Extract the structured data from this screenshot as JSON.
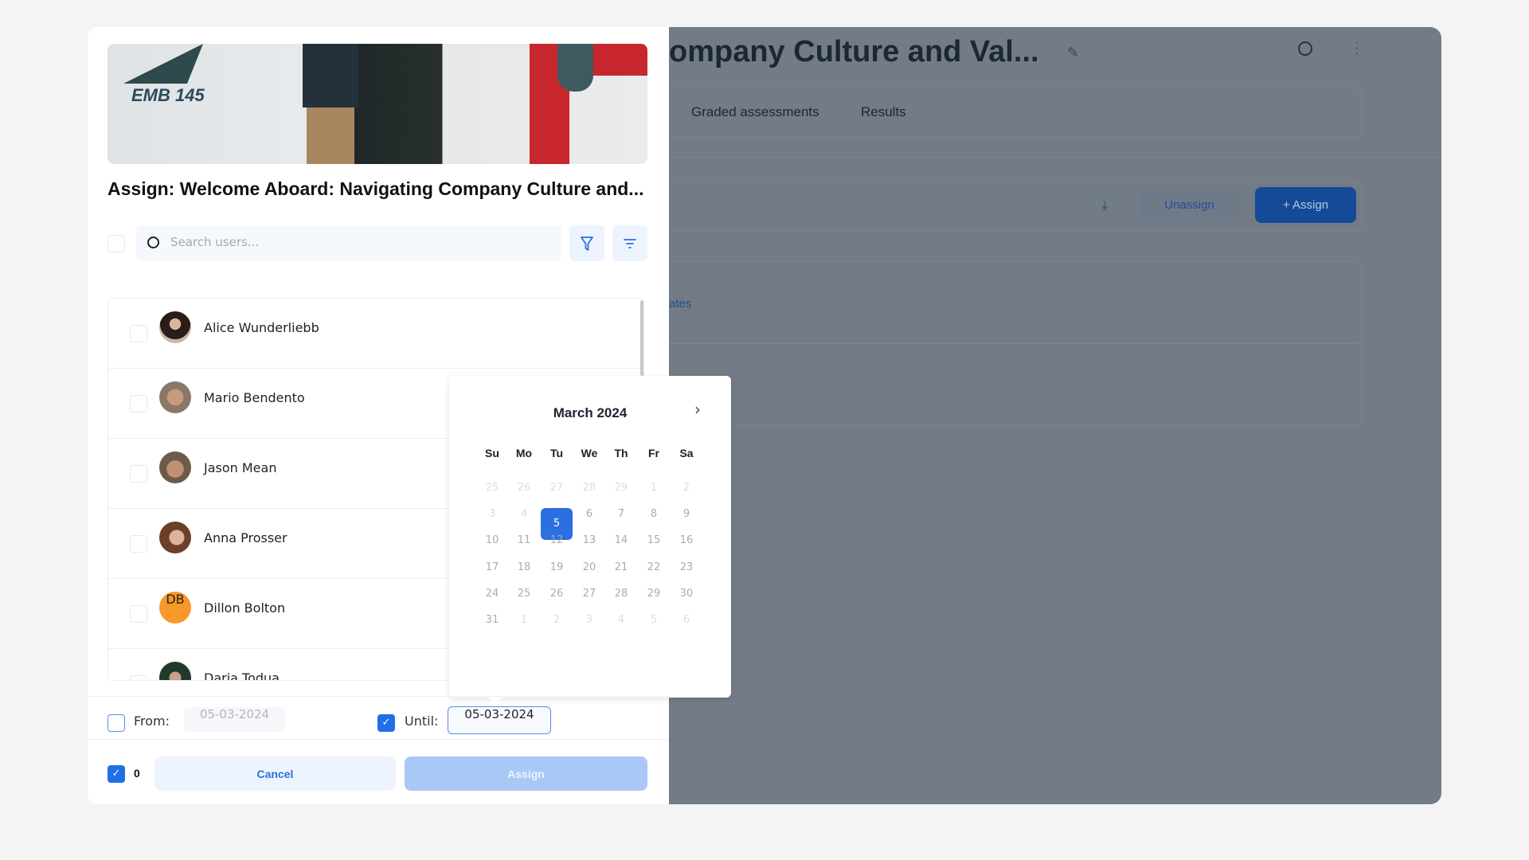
{
  "background_page": {
    "title": "ompany Culture and Val...",
    "tabs": [
      "Graded assessments",
      "Results"
    ],
    "unassign_label": "Unassign",
    "assign_label": "+ Assign",
    "link_fragment": "ates"
  },
  "modal": {
    "title": "Assign: Welcome Aboard: Navigating Company Culture and...",
    "hero_text": "EMB 145",
    "search": {
      "placeholder": "Search users..."
    },
    "users": [
      {
        "name": "Alice Wunderliebb",
        "avatar": "photo"
      },
      {
        "name": "Mario Bendento",
        "avatar": "photo"
      },
      {
        "name": "Jason Mean",
        "avatar": "photo"
      },
      {
        "name": "Anna Prosser",
        "avatar": "photo"
      },
      {
        "name": "Dillon Bolton",
        "initials": "DB",
        "avatar_color": "#f7982a"
      },
      {
        "name": "Daria Todua",
        "avatar": "photo"
      }
    ],
    "from": {
      "label": "From:",
      "value": "05-03-2024",
      "checked": false
    },
    "until": {
      "label": "Until:",
      "value": "05-03-2024",
      "checked": true
    },
    "selected_count": "0",
    "cancel_label": "Cancel",
    "assign_label": "Assign"
  },
  "calendar": {
    "month": "March 2024",
    "weekdays": [
      "Su",
      "Mo",
      "Tu",
      "We",
      "Th",
      "Fr",
      "Sa"
    ],
    "weeks": [
      [
        "25",
        "26",
        "27",
        "28",
        "29",
        "1",
        "2"
      ],
      [
        "3",
        "4",
        "5",
        "6",
        "7",
        "8",
        "9"
      ],
      [
        "10",
        "11",
        "12",
        "13",
        "14",
        "15",
        "16"
      ],
      [
        "17",
        "18",
        "19",
        "20",
        "21",
        "22",
        "23"
      ],
      [
        "24",
        "25",
        "26",
        "27",
        "28",
        "29",
        "30"
      ],
      [
        "31",
        "1",
        "2",
        "3",
        "4",
        "5",
        "6"
      ]
    ],
    "selected": "5",
    "accent": "#2b6fe0"
  }
}
